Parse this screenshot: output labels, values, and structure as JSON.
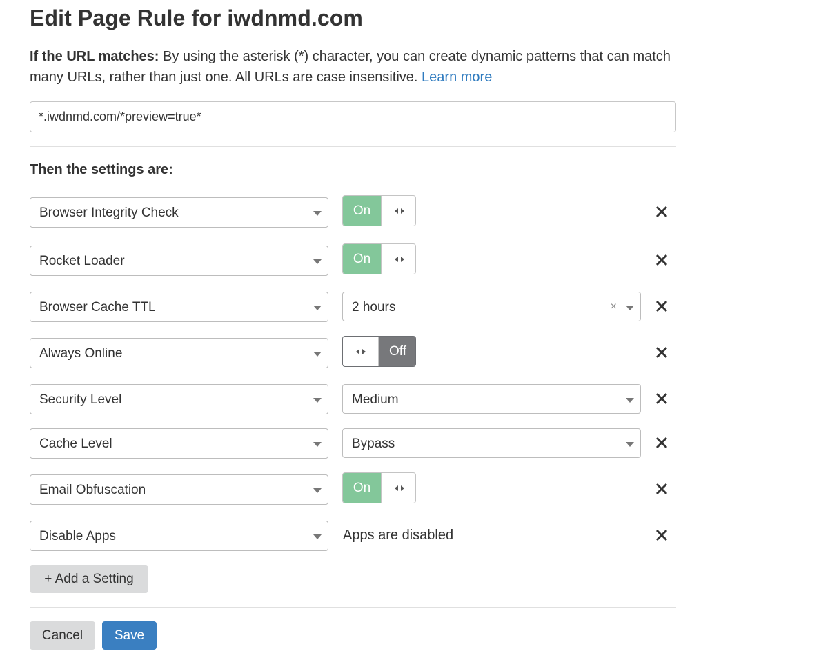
{
  "page": {
    "title": "Edit Page Rule for iwdnmd.com"
  },
  "intro": {
    "lead": "If the URL matches:",
    "text": " By using the asterisk (*) character, you can create dynamic patterns that can match many URLs, rather than just one. All URLs are case insensitive. ",
    "link": "Learn more"
  },
  "url_pattern": {
    "value": "*.iwdnmd.com/*preview=true*"
  },
  "settings_heading": "Then the settings are:",
  "settings": [
    {
      "name": "Browser Integrity Check",
      "control": "toggle",
      "toggle_label": "On",
      "state": "on"
    },
    {
      "name": "Rocket Loader",
      "control": "toggle",
      "toggle_label": "On",
      "state": "on"
    },
    {
      "name": "Browser Cache TTL",
      "control": "select",
      "value": "2 hours",
      "clear": "×"
    },
    {
      "name": "Always Online",
      "control": "toggle",
      "toggle_label": "Off",
      "state": "off"
    },
    {
      "name": "Security Level",
      "control": "select",
      "value": "Medium"
    },
    {
      "name": "Cache Level",
      "control": "select",
      "value": "Bypass"
    },
    {
      "name": "Email Obfuscation",
      "control": "toggle",
      "toggle_label": "On",
      "state": "on"
    },
    {
      "name": "Disable Apps",
      "control": "text",
      "value": "Apps are disabled"
    }
  ],
  "buttons": {
    "add_setting": "+ Add a Setting",
    "cancel": "Cancel",
    "save": "Save"
  },
  "colors": {
    "toggle_on": "#83c79a",
    "toggle_off": "#77787b",
    "primary": "#3a7fc1",
    "link": "#2f7bbf"
  }
}
